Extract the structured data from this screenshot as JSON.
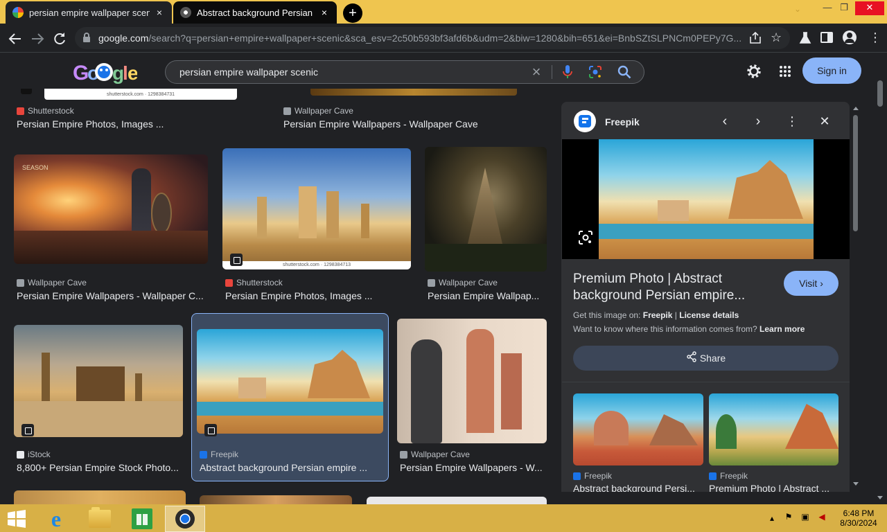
{
  "browser": {
    "tabs": [
      {
        "title": "persian empire wallpaper scenic",
        "close": "×",
        "active": false
      },
      {
        "title": "Abstract background Persian empire",
        "close": "×",
        "active": true
      }
    ],
    "new_tab": "+",
    "window_controls": {
      "minimize": "—",
      "maximize": "❐",
      "close": "✕"
    },
    "url_domain": "google.com",
    "url_path": "/search?q=persian+empire+wallpaper+scenic&sca_esv=2c50b593bf3afd6b&udm=2&biw=1280&bih=651&ei=BnbSZtSLPNCm0PEPy7G...",
    "accent": "#efc54f"
  },
  "google": {
    "logo": "Google",
    "query": "persian empire wallpaper scenic",
    "clear": "×",
    "sign_in": "Sign in"
  },
  "results": [
    {
      "source": "Shutterstock",
      "title": "Persian Empire Photos, Images ...",
      "credit": "shutterstock.com · 1298384731"
    },
    {
      "source": "Wallpaper Cave",
      "title": "Persian Empire Wallpapers - Wallpaper Cave"
    },
    {
      "source": "Wallpaper Cave",
      "title": "Persian Empire Wallpapers - Wallpaper C...",
      "caption": "SEASON"
    },
    {
      "source": "Shutterstock",
      "title": "Persian Empire Photos, Images ...",
      "credit": "shutterstock.com · 1298384713"
    },
    {
      "source": "Wallpaper Cave",
      "title": "Persian Empire Wallpap..."
    },
    {
      "source": "iStock",
      "title": "8,800+ Persian Empire Stock Photo..."
    },
    {
      "source": "Freepik",
      "title": "Abstract background Persian empire ..."
    },
    {
      "source": "Wallpaper Cave",
      "title": "Persian Empire Wallpapers - W..."
    }
  ],
  "panel": {
    "source": "Freepik",
    "title": "Premium Photo | Abstract background Persian empire...",
    "visit": "Visit",
    "get_image_prefix": "Get this image on:",
    "get_image_source": "Freepik",
    "separator": "|",
    "license": "License details",
    "know_where": "Want to know where this information comes from?",
    "learn_more": "Learn more",
    "share": "Share",
    "related": [
      {
        "source": "Freepik",
        "title": "Abstract background Persi..."
      },
      {
        "source": "Freepik",
        "title": "Premium Photo | Abstract ..."
      }
    ]
  },
  "taskbar": {
    "time": "6:48 PM",
    "date": "8/30/2024"
  }
}
